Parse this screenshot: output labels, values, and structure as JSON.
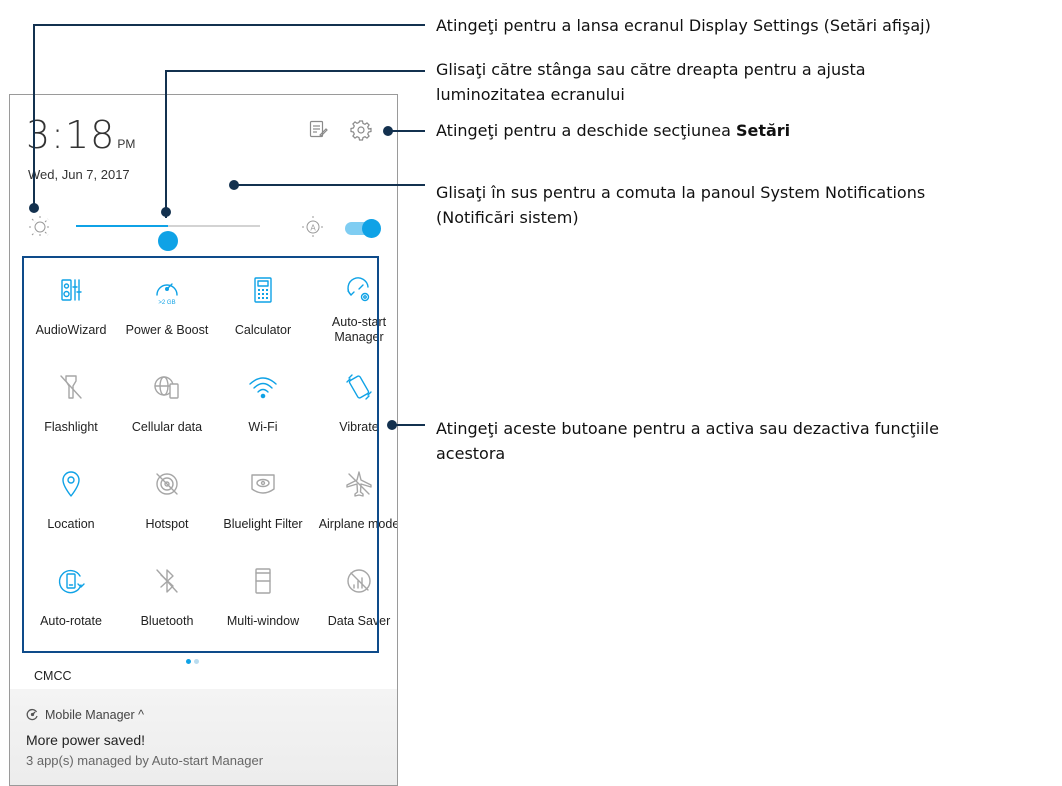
{
  "status": {
    "time": "3:18",
    "ampm": "PM",
    "date": "Wed, Jun 7, 2017"
  },
  "header_icons": [
    "notes-edit-icon",
    "gear-icon"
  ],
  "brightness": {
    "level_percent": 50,
    "auto_toggle_on": true,
    "icons": [
      "sun-icon",
      "auto-brightness-icon"
    ]
  },
  "quick_settings": [
    {
      "label": "AudioWizard",
      "icon": "audiowizard-icon",
      "active": true
    },
    {
      "label": "Power & Boost",
      "icon": "power-boost-icon",
      "active": true,
      "sub": ">2 GB"
    },
    {
      "label": "Calculator",
      "icon": "calculator-icon",
      "active": true
    },
    {
      "label": "Auto-start\nManager",
      "icon": "auto-start-icon",
      "active": true
    },
    {
      "label": "Flashlight",
      "icon": "flashlight-icon",
      "active": false
    },
    {
      "label": "Cellular data",
      "icon": "cellular-data-icon",
      "active": false
    },
    {
      "label": "Wi-Fi",
      "icon": "wifi-icon",
      "active": true
    },
    {
      "label": "Vibrate",
      "icon": "vibrate-icon",
      "active": true
    },
    {
      "label": "Location",
      "icon": "location-icon",
      "active": true
    },
    {
      "label": "Hotspot",
      "icon": "hotspot-icon",
      "active": false
    },
    {
      "label": "Bluelight Filter",
      "icon": "bluelight-filter-icon",
      "active": false
    },
    {
      "label": "Airplane mode",
      "icon": "airplane-icon",
      "active": false
    },
    {
      "label": "Auto-rotate",
      "icon": "auto-rotate-icon",
      "active": true
    },
    {
      "label": "Bluetooth",
      "icon": "bluetooth-icon",
      "active": false
    },
    {
      "label": "Multi-window",
      "icon": "multi-window-icon",
      "active": false
    },
    {
      "label": "Data Saver",
      "icon": "data-saver-icon",
      "active": false
    }
  ],
  "carrier": "CMCC",
  "notification": {
    "app": "Mobile Manager ^",
    "title": "More power saved!",
    "text": "3 app(s) managed by Auto-start Manager"
  },
  "callouts": {
    "display_settings": "Atingeţi pentru a lansa ecranul Display Settings (Setări afişaj)",
    "brightness_1": "Glisaţi către stânga sau către dreapta pentru a ajusta",
    "brightness_2": "luminozitatea ecranului",
    "settings_prefix": "Atingeţi pentru a deschide secţiunea ",
    "settings_bold": "Setări",
    "notifications_1": "Glisaţi în sus pentru a comuta la panoul System Notifications",
    "notifications_2": "(Notificări sistem)",
    "toggles_1": "Atingeţi aceste butoane pentru a activa sau dezactiva funcţiile",
    "toggles_2": "acestora"
  },
  "colors": {
    "accent": "#0fa2e6",
    "inactive": "#a6a6a6",
    "callout": "#13314f",
    "highlight_box": "#0e4b8a"
  }
}
